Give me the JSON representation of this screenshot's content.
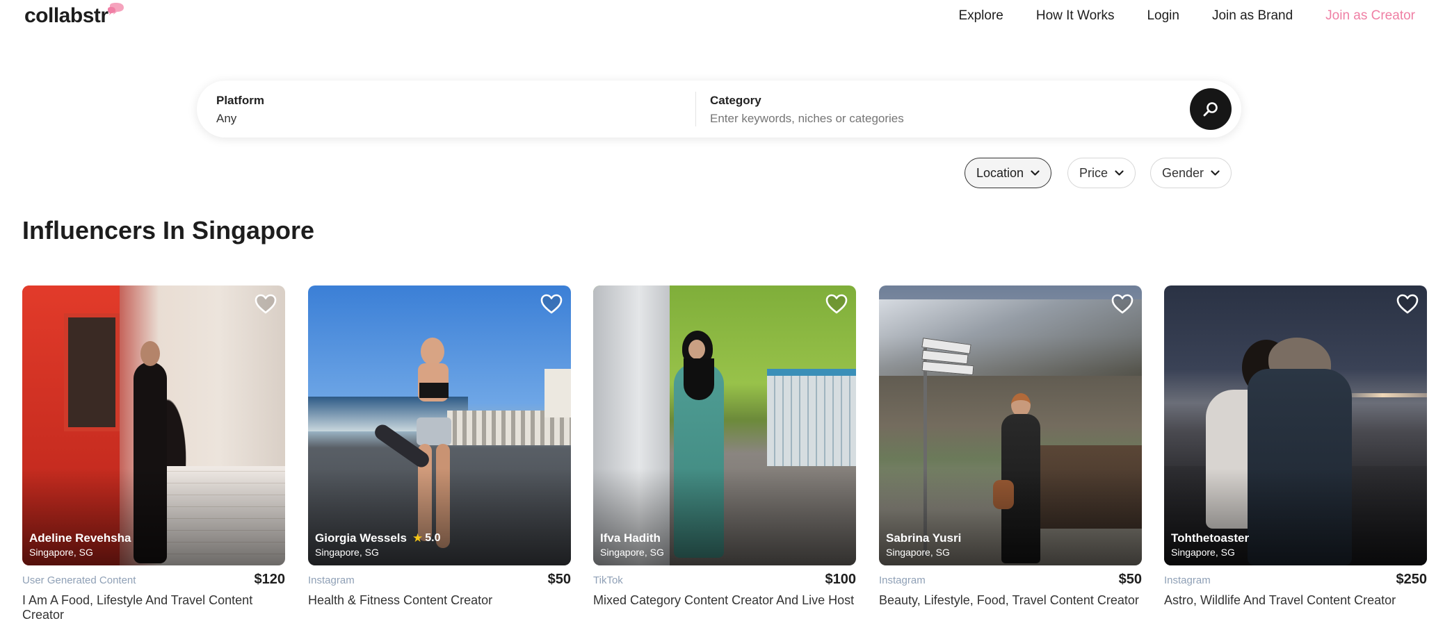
{
  "header": {
    "logo": "collabstr",
    "nav": [
      "Explore",
      "How It Works",
      "Login",
      "Join as Brand",
      "Join as Creator"
    ]
  },
  "search": {
    "platform_label": "Platform",
    "platform_value": "Any",
    "category_label": "Category",
    "category_placeholder": "Enter keywords, niches or categories"
  },
  "filters": [
    "Location",
    "Price",
    "Gender"
  ],
  "page_title": "Influencers In Singapore",
  "cards": [
    {
      "name": "Adeline Revehsha",
      "location": "Singapore, SG",
      "platform": "User Generated Content",
      "price": "$120",
      "description": "I Am A Food, Lifestyle And Travel Content Creator",
      "rating": ""
    },
    {
      "name": "Giorgia Wessels",
      "location": "Singapore, SG",
      "platform": "Instagram",
      "price": "$50",
      "description": "Health & Fitness Content Creator",
      "rating": "5.0"
    },
    {
      "name": "Ifva Hadith",
      "location": "Singapore, SG",
      "platform": "TikTok",
      "price": "$100",
      "description": "Mixed Category Content Creator And Live Host",
      "rating": ""
    },
    {
      "name": "Sabrina Yusri",
      "location": "Singapore, SG",
      "platform": "Instagram",
      "price": "$50",
      "description": "Beauty, Lifestyle, Food, Travel Content Creator",
      "rating": ""
    },
    {
      "name": "Tohthetoaster",
      "location": "Singapore, SG",
      "platform": "Instagram",
      "price": "$250",
      "description": "Astro, Wildlife And Travel Content Creator",
      "rating": ""
    }
  ],
  "colors": {
    "accent_pink": "#ef7fa4",
    "search_button": "#161616",
    "platform_text": "#8fa0b6"
  }
}
